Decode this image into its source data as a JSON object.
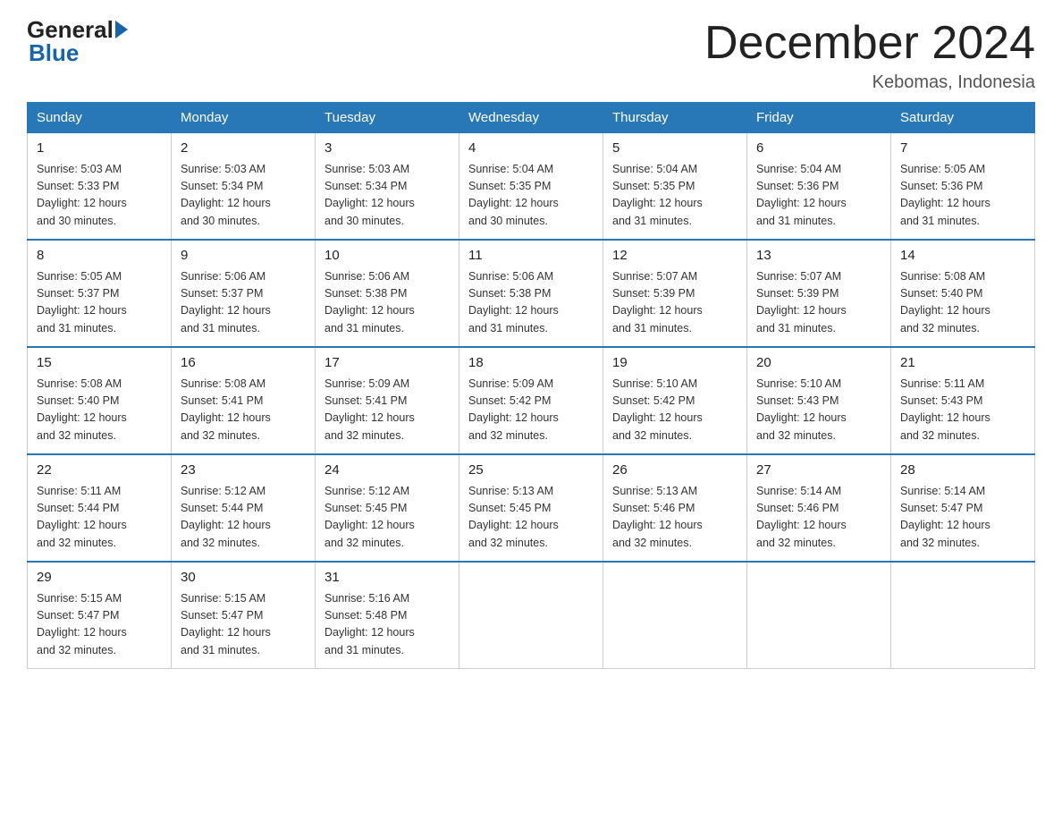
{
  "logo": {
    "general": "General",
    "blue": "Blue"
  },
  "header": {
    "month": "December 2024",
    "location": "Kebomas, Indonesia"
  },
  "days_of_week": [
    "Sunday",
    "Monday",
    "Tuesday",
    "Wednesday",
    "Thursday",
    "Friday",
    "Saturday"
  ],
  "weeks": [
    [
      {
        "day": "1",
        "sunrise": "5:03 AM",
        "sunset": "5:33 PM",
        "daylight": "12 hours and 30 minutes."
      },
      {
        "day": "2",
        "sunrise": "5:03 AM",
        "sunset": "5:34 PM",
        "daylight": "12 hours and 30 minutes."
      },
      {
        "day": "3",
        "sunrise": "5:03 AM",
        "sunset": "5:34 PM",
        "daylight": "12 hours and 30 minutes."
      },
      {
        "day": "4",
        "sunrise": "5:04 AM",
        "sunset": "5:35 PM",
        "daylight": "12 hours and 30 minutes."
      },
      {
        "day": "5",
        "sunrise": "5:04 AM",
        "sunset": "5:35 PM",
        "daylight": "12 hours and 31 minutes."
      },
      {
        "day": "6",
        "sunrise": "5:04 AM",
        "sunset": "5:36 PM",
        "daylight": "12 hours and 31 minutes."
      },
      {
        "day": "7",
        "sunrise": "5:05 AM",
        "sunset": "5:36 PM",
        "daylight": "12 hours and 31 minutes."
      }
    ],
    [
      {
        "day": "8",
        "sunrise": "5:05 AM",
        "sunset": "5:37 PM",
        "daylight": "12 hours and 31 minutes."
      },
      {
        "day": "9",
        "sunrise": "5:06 AM",
        "sunset": "5:37 PM",
        "daylight": "12 hours and 31 minutes."
      },
      {
        "day": "10",
        "sunrise": "5:06 AM",
        "sunset": "5:38 PM",
        "daylight": "12 hours and 31 minutes."
      },
      {
        "day": "11",
        "sunrise": "5:06 AM",
        "sunset": "5:38 PM",
        "daylight": "12 hours and 31 minutes."
      },
      {
        "day": "12",
        "sunrise": "5:07 AM",
        "sunset": "5:39 PM",
        "daylight": "12 hours and 31 minutes."
      },
      {
        "day": "13",
        "sunrise": "5:07 AM",
        "sunset": "5:39 PM",
        "daylight": "12 hours and 31 minutes."
      },
      {
        "day": "14",
        "sunrise": "5:08 AM",
        "sunset": "5:40 PM",
        "daylight": "12 hours and 32 minutes."
      }
    ],
    [
      {
        "day": "15",
        "sunrise": "5:08 AM",
        "sunset": "5:40 PM",
        "daylight": "12 hours and 32 minutes."
      },
      {
        "day": "16",
        "sunrise": "5:08 AM",
        "sunset": "5:41 PM",
        "daylight": "12 hours and 32 minutes."
      },
      {
        "day": "17",
        "sunrise": "5:09 AM",
        "sunset": "5:41 PM",
        "daylight": "12 hours and 32 minutes."
      },
      {
        "day": "18",
        "sunrise": "5:09 AM",
        "sunset": "5:42 PM",
        "daylight": "12 hours and 32 minutes."
      },
      {
        "day": "19",
        "sunrise": "5:10 AM",
        "sunset": "5:42 PM",
        "daylight": "12 hours and 32 minutes."
      },
      {
        "day": "20",
        "sunrise": "5:10 AM",
        "sunset": "5:43 PM",
        "daylight": "12 hours and 32 minutes."
      },
      {
        "day": "21",
        "sunrise": "5:11 AM",
        "sunset": "5:43 PM",
        "daylight": "12 hours and 32 minutes."
      }
    ],
    [
      {
        "day": "22",
        "sunrise": "5:11 AM",
        "sunset": "5:44 PM",
        "daylight": "12 hours and 32 minutes."
      },
      {
        "day": "23",
        "sunrise": "5:12 AM",
        "sunset": "5:44 PM",
        "daylight": "12 hours and 32 minutes."
      },
      {
        "day": "24",
        "sunrise": "5:12 AM",
        "sunset": "5:45 PM",
        "daylight": "12 hours and 32 minutes."
      },
      {
        "day": "25",
        "sunrise": "5:13 AM",
        "sunset": "5:45 PM",
        "daylight": "12 hours and 32 minutes."
      },
      {
        "day": "26",
        "sunrise": "5:13 AM",
        "sunset": "5:46 PM",
        "daylight": "12 hours and 32 minutes."
      },
      {
        "day": "27",
        "sunrise": "5:14 AM",
        "sunset": "5:46 PM",
        "daylight": "12 hours and 32 minutes."
      },
      {
        "day": "28",
        "sunrise": "5:14 AM",
        "sunset": "5:47 PM",
        "daylight": "12 hours and 32 minutes."
      }
    ],
    [
      {
        "day": "29",
        "sunrise": "5:15 AM",
        "sunset": "5:47 PM",
        "daylight": "12 hours and 32 minutes."
      },
      {
        "day": "30",
        "sunrise": "5:15 AM",
        "sunset": "5:47 PM",
        "daylight": "12 hours and 31 minutes."
      },
      {
        "day": "31",
        "sunrise": "5:16 AM",
        "sunset": "5:48 PM",
        "daylight": "12 hours and 31 minutes."
      },
      null,
      null,
      null,
      null
    ]
  ],
  "labels": {
    "sunrise": "Sunrise:",
    "sunset": "Sunset:",
    "daylight": "Daylight:"
  }
}
